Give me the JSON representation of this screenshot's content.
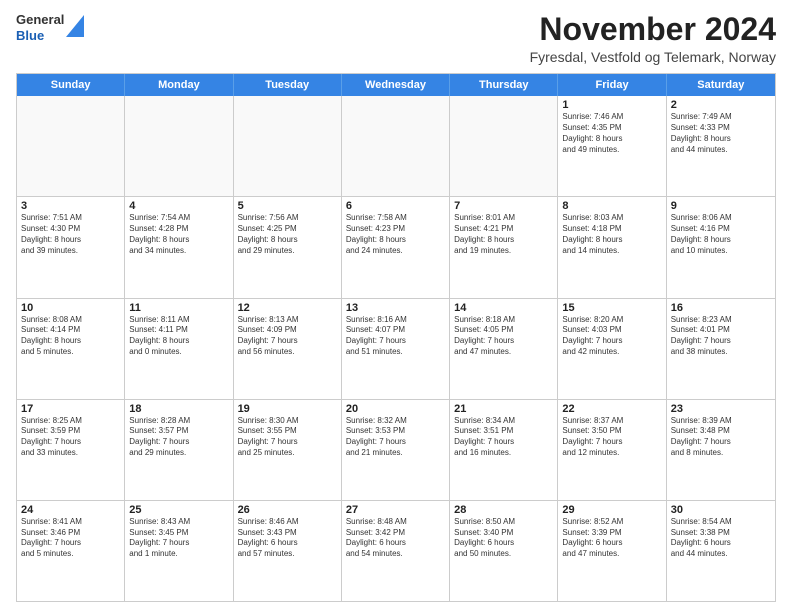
{
  "header": {
    "logo_line1": "General",
    "logo_line2": "Blue",
    "month_title": "November 2024",
    "subtitle": "Fyresdal, Vestfold og Telemark, Norway"
  },
  "weekdays": [
    "Sunday",
    "Monday",
    "Tuesday",
    "Wednesday",
    "Thursday",
    "Friday",
    "Saturday"
  ],
  "rows": [
    [
      {
        "day": "",
        "info": ""
      },
      {
        "day": "",
        "info": ""
      },
      {
        "day": "",
        "info": ""
      },
      {
        "day": "",
        "info": ""
      },
      {
        "day": "",
        "info": ""
      },
      {
        "day": "1",
        "info": "Sunrise: 7:46 AM\nSunset: 4:35 PM\nDaylight: 8 hours\nand 49 minutes."
      },
      {
        "day": "2",
        "info": "Sunrise: 7:49 AM\nSunset: 4:33 PM\nDaylight: 8 hours\nand 44 minutes."
      }
    ],
    [
      {
        "day": "3",
        "info": "Sunrise: 7:51 AM\nSunset: 4:30 PM\nDaylight: 8 hours\nand 39 minutes."
      },
      {
        "day": "4",
        "info": "Sunrise: 7:54 AM\nSunset: 4:28 PM\nDaylight: 8 hours\nand 34 minutes."
      },
      {
        "day": "5",
        "info": "Sunrise: 7:56 AM\nSunset: 4:25 PM\nDaylight: 8 hours\nand 29 minutes."
      },
      {
        "day": "6",
        "info": "Sunrise: 7:58 AM\nSunset: 4:23 PM\nDaylight: 8 hours\nand 24 minutes."
      },
      {
        "day": "7",
        "info": "Sunrise: 8:01 AM\nSunset: 4:21 PM\nDaylight: 8 hours\nand 19 minutes."
      },
      {
        "day": "8",
        "info": "Sunrise: 8:03 AM\nSunset: 4:18 PM\nDaylight: 8 hours\nand 14 minutes."
      },
      {
        "day": "9",
        "info": "Sunrise: 8:06 AM\nSunset: 4:16 PM\nDaylight: 8 hours\nand 10 minutes."
      }
    ],
    [
      {
        "day": "10",
        "info": "Sunrise: 8:08 AM\nSunset: 4:14 PM\nDaylight: 8 hours\nand 5 minutes."
      },
      {
        "day": "11",
        "info": "Sunrise: 8:11 AM\nSunset: 4:11 PM\nDaylight: 8 hours\nand 0 minutes."
      },
      {
        "day": "12",
        "info": "Sunrise: 8:13 AM\nSunset: 4:09 PM\nDaylight: 7 hours\nand 56 minutes."
      },
      {
        "day": "13",
        "info": "Sunrise: 8:16 AM\nSunset: 4:07 PM\nDaylight: 7 hours\nand 51 minutes."
      },
      {
        "day": "14",
        "info": "Sunrise: 8:18 AM\nSunset: 4:05 PM\nDaylight: 7 hours\nand 47 minutes."
      },
      {
        "day": "15",
        "info": "Sunrise: 8:20 AM\nSunset: 4:03 PM\nDaylight: 7 hours\nand 42 minutes."
      },
      {
        "day": "16",
        "info": "Sunrise: 8:23 AM\nSunset: 4:01 PM\nDaylight: 7 hours\nand 38 minutes."
      }
    ],
    [
      {
        "day": "17",
        "info": "Sunrise: 8:25 AM\nSunset: 3:59 PM\nDaylight: 7 hours\nand 33 minutes."
      },
      {
        "day": "18",
        "info": "Sunrise: 8:28 AM\nSunset: 3:57 PM\nDaylight: 7 hours\nand 29 minutes."
      },
      {
        "day": "19",
        "info": "Sunrise: 8:30 AM\nSunset: 3:55 PM\nDaylight: 7 hours\nand 25 minutes."
      },
      {
        "day": "20",
        "info": "Sunrise: 8:32 AM\nSunset: 3:53 PM\nDaylight: 7 hours\nand 21 minutes."
      },
      {
        "day": "21",
        "info": "Sunrise: 8:34 AM\nSunset: 3:51 PM\nDaylight: 7 hours\nand 16 minutes."
      },
      {
        "day": "22",
        "info": "Sunrise: 8:37 AM\nSunset: 3:50 PM\nDaylight: 7 hours\nand 12 minutes."
      },
      {
        "day": "23",
        "info": "Sunrise: 8:39 AM\nSunset: 3:48 PM\nDaylight: 7 hours\nand 8 minutes."
      }
    ],
    [
      {
        "day": "24",
        "info": "Sunrise: 8:41 AM\nSunset: 3:46 PM\nDaylight: 7 hours\nand 5 minutes."
      },
      {
        "day": "25",
        "info": "Sunrise: 8:43 AM\nSunset: 3:45 PM\nDaylight: 7 hours\nand 1 minute."
      },
      {
        "day": "26",
        "info": "Sunrise: 8:46 AM\nSunset: 3:43 PM\nDaylight: 6 hours\nand 57 minutes."
      },
      {
        "day": "27",
        "info": "Sunrise: 8:48 AM\nSunset: 3:42 PM\nDaylight: 6 hours\nand 54 minutes."
      },
      {
        "day": "28",
        "info": "Sunrise: 8:50 AM\nSunset: 3:40 PM\nDaylight: 6 hours\nand 50 minutes."
      },
      {
        "day": "29",
        "info": "Sunrise: 8:52 AM\nSunset: 3:39 PM\nDaylight: 6 hours\nand 47 minutes."
      },
      {
        "day": "30",
        "info": "Sunrise: 8:54 AM\nSunset: 3:38 PM\nDaylight: 6 hours\nand 44 minutes."
      }
    ]
  ]
}
